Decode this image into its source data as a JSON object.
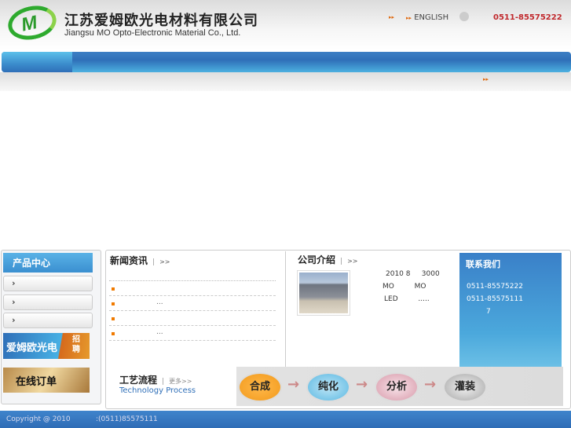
{
  "header": {
    "logo_text": "M",
    "company_cn": "江苏爱姆欧光电材料有限公司",
    "company_en": "Jiangsu  MO Opto-Electronic Material Co., Ltd.",
    "english_link": "ENGLISH",
    "phone": "0511-85575222"
  },
  "sidebar": {
    "title": "产品中心",
    "categories": [
      "›",
      "›",
      "›"
    ],
    "recruit_label": "爱姆欧光电",
    "recruit_tag": "招聘",
    "order_label": "在线订单"
  },
  "news": {
    "title": "新闻资讯",
    "more": ">>",
    "items": [
      {
        "text": ""
      },
      {
        "text": "..."
      },
      {
        "text": ""
      },
      {
        "text": "..."
      }
    ]
  },
  "about": {
    "title": "公司介绍",
    "more": ">>",
    "lines": [
      "2010 8     3000",
      "MO         MO",
      "LED         ....."
    ]
  },
  "contact": {
    "title": "联系我们",
    "phone1": "0511-85575222",
    "phone2": "0511-85575111",
    "line3": "7"
  },
  "process": {
    "title": "工艺流程",
    "more": "更多>>",
    "subtitle": "Technology Process",
    "steps": [
      "合成",
      "纯化",
      "分析",
      "灌装"
    ]
  },
  "footer": {
    "copyright": "Copyright @ 2010",
    "phone": ":(0511)85575111"
  },
  "colors": {
    "nav": "#2f6fb8",
    "accent": "#e06a10",
    "phone": "#c0282c"
  }
}
